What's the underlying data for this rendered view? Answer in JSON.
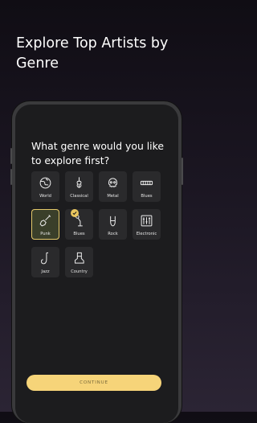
{
  "headline": "Explore Top Artists by Genre",
  "question": "What genre would you like to explore first?",
  "genres": [
    {
      "label": "World",
      "icon": "globe-icon"
    },
    {
      "label": "Classical",
      "icon": "violin-icon"
    },
    {
      "label": "Metal",
      "icon": "skull-icon"
    },
    {
      "label": "Blues",
      "icon": "harmonica-icon"
    },
    {
      "label": "Punk",
      "icon": "punk-guitar-icon",
      "selected": true
    },
    {
      "label": "Blues",
      "icon": "microphone-stand-icon"
    },
    {
      "label": "Rock",
      "icon": "rock-hand-icon"
    },
    {
      "label": "Electronic",
      "icon": "mixer-icon"
    },
    {
      "label": "Jazz",
      "icon": "saxophone-icon"
    },
    {
      "label": "Country",
      "icon": "cowboy-boot-icon"
    }
  ],
  "cta": {
    "label": "CONTINUE"
  },
  "colors": {
    "accent": "#f6d479",
    "check": "#e9c65f",
    "tile": "#2a2a2c",
    "screen": "#1c1c1e"
  }
}
